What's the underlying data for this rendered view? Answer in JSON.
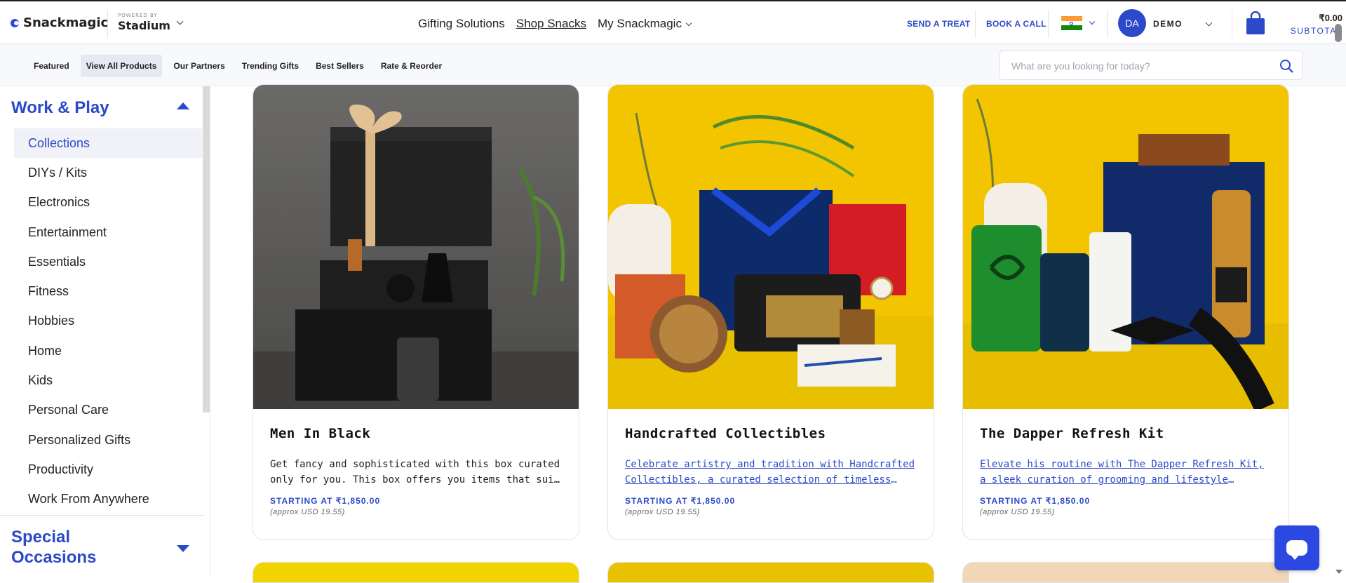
{
  "header": {
    "brand": "Snackmagic",
    "powered_by": "POWERED BY",
    "partner": "Stadium",
    "nav": [
      "Gifting Solutions",
      "Shop Snacks",
      "My Snackmagic"
    ],
    "send_treat": "SEND A TREAT",
    "book_call": "BOOK A CALL",
    "user_initials": "DA",
    "user_name": "DEMO",
    "cart_amount": "₹0.00",
    "cart_label": "SUBTOTAL",
    "flag_colors": [
      "#ff9933",
      "#ffffff",
      "#138808"
    ]
  },
  "subnav": {
    "items": [
      "Featured",
      "View All Products",
      "Our Partners",
      "Trending Gifts",
      "Best Sellers",
      "Rate & Reorder"
    ],
    "active_index": 1,
    "search_placeholder": "What are you looking for today?"
  },
  "sidebar": {
    "section1": "Work & Play",
    "categories": [
      "Collections",
      "DIYs / Kits",
      "Electronics",
      "Entertainment",
      "Essentials",
      "Fitness",
      "Hobbies",
      "Home",
      "Kids",
      "Personal Care",
      "Personalized Gifts",
      "Productivity",
      "Work From Anywhere"
    ],
    "active_category": "Collections",
    "section2_line1": "Special",
    "section2_line2": "Occasions"
  },
  "products": [
    {
      "title": "Men In Black",
      "description": "Get fancy and sophisticated with this box curated only for you. This box offers you items that suit your style.",
      "price": "STARTING AT ₹1,850.00",
      "approx": "(approx USD 19.55)",
      "image_theme": "dark-gift-box"
    },
    {
      "title": "Handcrafted Collectibles",
      "description": "Celebrate artistry and tradition with Handcrafted Collectibles, a curated selection of timeless pieces made with care.",
      "price": "STARTING AT ₹1,850.00",
      "approx": "(approx USD 19.55)",
      "image_theme": "yellow-collectibles"
    },
    {
      "title": "The Dapper Refresh Kit",
      "description": "Elevate his routine with The Dapper Refresh Kit, a sleek curation of grooming and lifestyle essentials for the modern man.",
      "price": "STARTING AT ₹1,850.00",
      "approx": "(approx USD 19.55)",
      "image_theme": "yellow-grooming"
    }
  ],
  "colors": {
    "accent": "#2b49c8",
    "chat": "#2b49e0"
  }
}
